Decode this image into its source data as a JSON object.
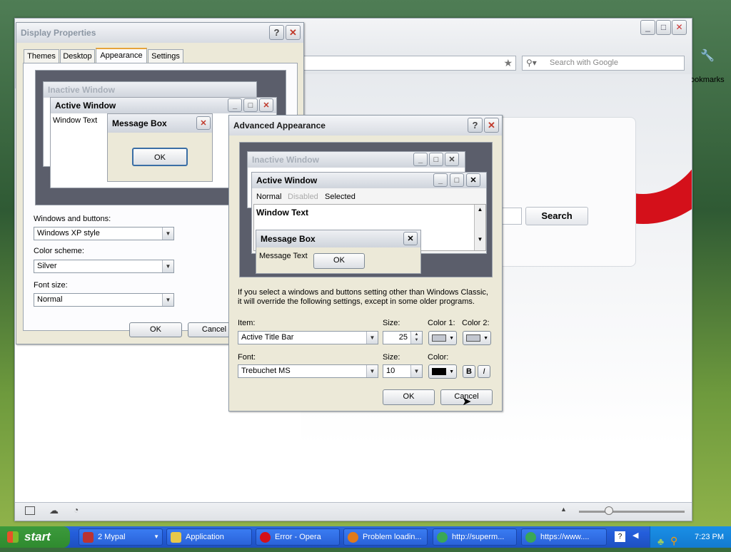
{
  "browser": {
    "search_placeholder": "Search with Google",
    "bookmarks_label": "ookmarks",
    "search_button": "Search"
  },
  "display_properties": {
    "title": "Display Properties",
    "tabs": [
      "Themes",
      "Desktop",
      "Appearance",
      "Settings"
    ],
    "preview": {
      "inactive_window": "Inactive Window",
      "active_window": "Active Window",
      "window_text": "Window Text",
      "message_box": "Message Box",
      "ok": "OK"
    },
    "windows_and_buttons_label": "Windows and buttons:",
    "windows_and_buttons_value": "Windows XP style",
    "color_scheme_label": "Color scheme:",
    "color_scheme_value": "Silver",
    "font_size_label": "Font size:",
    "font_size_value": "Normal",
    "ok_button": "OK",
    "cancel_button": "Cancel"
  },
  "advanced": {
    "title": "Advanced Appearance",
    "preview": {
      "inactive_window": "Inactive Window",
      "active_window": "Active Window",
      "menu_normal": "Normal",
      "menu_disabled": "Disabled",
      "menu_selected": "Selected",
      "window_text": "Window Text",
      "message_box": "Message Box",
      "message_text": "Message Text",
      "ok": "OK"
    },
    "info_line1": "If you select a windows and buttons setting other than Windows Classic,",
    "info_line2": "it will override the following settings, except in some older programs.",
    "item_label": "Item:",
    "item_value": "Active Title Bar",
    "size_label": "Size:",
    "size_value": "25",
    "color1_label": "Color 1:",
    "color2_label": "Color 2:",
    "font_label": "Font:",
    "font_value": "Trebuchet MS",
    "font_size_label": "Size:",
    "font_size_value": "10",
    "color_label": "Color:",
    "bold_label": "B",
    "italic_label": "I",
    "ok_button": "OK",
    "cancel_button": "Cancel"
  },
  "taskbar": {
    "start_label": "start",
    "tasks": [
      {
        "label": "2 Mypal"
      },
      {
        "label": "Application"
      },
      {
        "label": "Error - Opera"
      },
      {
        "label": "Problem loadin..."
      },
      {
        "label": "http://superm..."
      },
      {
        "label": "https://www...."
      }
    ],
    "clock": "7:23 PM"
  },
  "colors": {
    "opera_red": "#d4101a",
    "color1_swatch": "#c3c7d0",
    "color2_swatch": "#c3c7d0",
    "font_color_swatch": "#000000"
  }
}
